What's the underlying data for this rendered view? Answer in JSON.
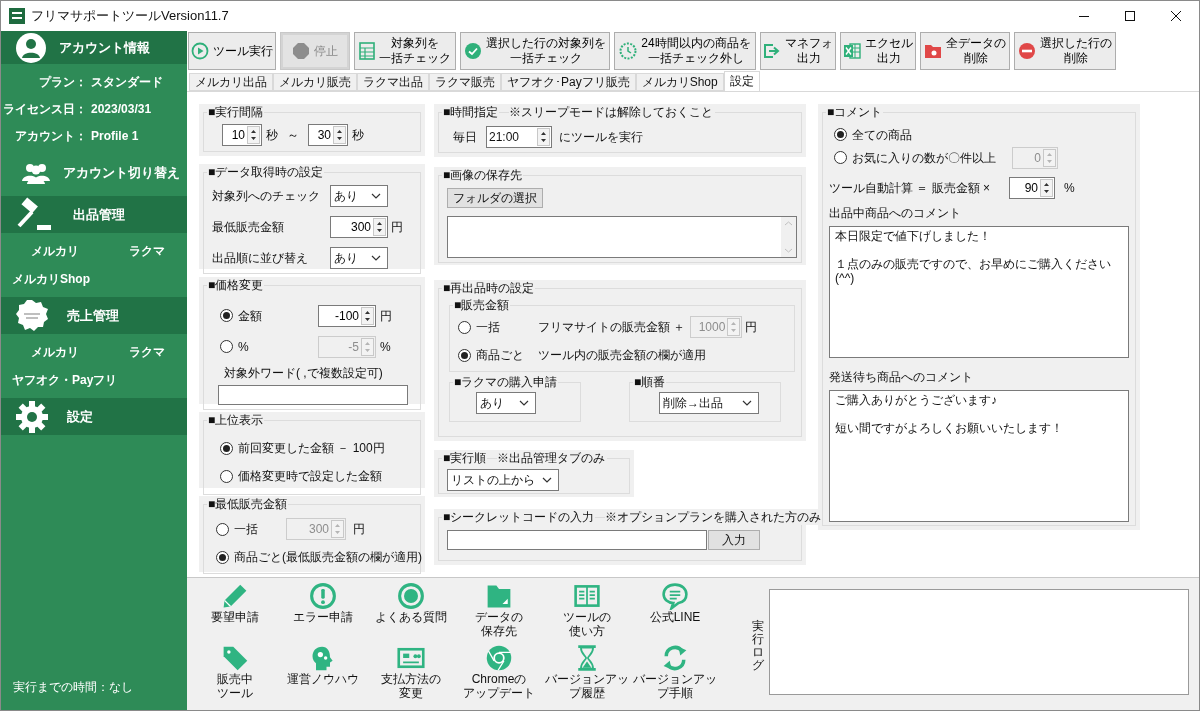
{
  "window": {
    "title": "フリマサポートツールVersion11.7"
  },
  "sidebar": {
    "account": {
      "label": "アカウント情報"
    },
    "info": [
      {
        "label": "プラン：",
        "value": "スタンダード"
      },
      {
        "label": "ライセンス日：",
        "value": "2023/03/31"
      },
      {
        "label": "アカウント：",
        "value": "Profile 1"
      }
    ],
    "switch_account": {
      "label": "アカウント切り替え"
    },
    "sections": [
      {
        "label": "出品管理",
        "rows": [
          [
            "メルカリ",
            "ラクマ"
          ],
          [
            "メルカリShop"
          ]
        ]
      },
      {
        "label": "売上管理",
        "rows": [
          [
            "メルカリ",
            "ラクマ"
          ],
          [
            "ヤフオク・Payフリ"
          ]
        ]
      },
      {
        "label": "設定"
      }
    ],
    "status": "実行までの時間：なし"
  },
  "toolbar": [
    {
      "lines": [
        "ツール実行"
      ],
      "disabled": false
    },
    {
      "lines": [
        "停止"
      ],
      "disabled": true
    },
    {
      "lines": [
        "対象列を",
        "一括チェック"
      ],
      "disabled": false
    },
    {
      "lines": [
        "選択した行の対象列を",
        "一括チェック"
      ],
      "disabled": false
    },
    {
      "lines": [
        "24時間以内の商品を",
        "一括チェック外し"
      ],
      "disabled": false
    },
    {
      "lines": [
        "マネフォ",
        "出力"
      ],
      "disabled": false
    },
    {
      "lines": [
        "エクセル",
        "出力"
      ],
      "disabled": false
    },
    {
      "lines": [
        "全データの",
        "削除"
      ],
      "disabled": false
    },
    {
      "lines": [
        "選択した行の",
        "削除"
      ],
      "disabled": false
    }
  ],
  "tabs": [
    {
      "label": "メルカリ出品",
      "selected": false
    },
    {
      "label": "メルカリ販売",
      "selected": false
    },
    {
      "label": "ラクマ出品",
      "selected": false
    },
    {
      "label": "ラクマ販売",
      "selected": false
    },
    {
      "label": "ヤフオク･Payフリ販売",
      "selected": false
    },
    {
      "label": "メルカリShop",
      "selected": false
    },
    {
      "label": "設定",
      "selected": true
    }
  ],
  "settings": {
    "interval": {
      "title": "■実行間隔",
      "from": {
        "value": "10",
        "disabled": false
      },
      "from_unit": "秒",
      "separator": "～",
      "to": {
        "value": "30",
        "disabled": false
      },
      "to_unit": "秒"
    },
    "data_fetch": {
      "title": "■データ取得時の設定",
      "rows": [
        {
          "kind": "select",
          "label": "対象列へのチェック",
          "value": "あり"
        },
        {
          "kind": "spin",
          "label": "最低販売金額",
          "value": "300",
          "disabled": false,
          "unit": "円"
        },
        {
          "kind": "select",
          "label": "出品順に並び替え",
          "value": "あり"
        }
      ]
    },
    "price_change": {
      "title": "■価格変更",
      "options": [
        {
          "label": "金額",
          "selected": true,
          "value": "-100",
          "disabled": false,
          "unit": "円"
        },
        {
          "label": "%",
          "selected": false,
          "value": "-5",
          "disabled": true,
          "unit": "%"
        }
      ],
      "exclude_label": "対象外ワード( ,で複数設定可)"
    },
    "top_display": {
      "title": "■上位表示",
      "options": [
        {
          "label": "前回変更した金額 － 100円",
          "selected": true
        },
        {
          "label": "価格変更時で設定した金額",
          "selected": false
        }
      ]
    },
    "min_price": {
      "title": "■最低販売金額",
      "options": [
        {
          "label": "一括",
          "selected": false,
          "value": "300",
          "disabled": true,
          "unit": "円"
        },
        {
          "label": "商品ごと(最低販売金額の欄が適用)",
          "selected": true
        }
      ]
    },
    "schedule": {
      "title": "■時間指定",
      "note": "※スリープモードは解除しておくこと",
      "prefix": "毎日",
      "time": "21:00",
      "suffix": "にツールを実行"
    },
    "image_folder": {
      "title": "■画像の保存先",
      "button": "フォルダの選択"
    },
    "relist": {
      "title": "■再出品時の設定",
      "price": {
        "title": "■販売金額",
        "options": [
          {
            "label": "一括",
            "description": "フリマサイトの販売金額 ＋",
            "selected": false,
            "value": "1000",
            "disabled": true,
            "unit": "円"
          },
          {
            "label": "商品ごと",
            "description": "ツール内の販売金額の欄が適用",
            "selected": true
          }
        ]
      },
      "rakuma": {
        "title": "■ラクマの購入申請",
        "value": "あり"
      },
      "order": {
        "title": "■順番",
        "value": "削除→出品"
      }
    },
    "exec_order": {
      "title": "■実行順",
      "note": "※出品管理タブのみ",
      "value": "リストの上から"
    },
    "secret": {
      "title": "■シークレットコードの入力",
      "note": "※オプションプランを購入された方のみ",
      "button": "入力"
    },
    "comment": {
      "title": "■コメント",
      "options": [
        {
          "label": "全ての商品",
          "selected": true
        },
        {
          "label": "お気に入りの数が〇件以上",
          "selected": false,
          "value": "0",
          "disabled": true
        }
      ],
      "auto_calc": {
        "label": "ツール自動計算 ＝ 販売金額 ×",
        "value": "90",
        "disabled": false,
        "unit": "%"
      },
      "listing_label": "出品中商品へのコメント",
      "listing_comment": [
        "本日限定で値下げしました！",
        "１点のみの販売ですので、お早めにご購入ください(^^)"
      ],
      "shipping_label": "発送待ち商品へのコメント",
      "shipping_comment": [
        "ご購入ありがとうございます♪",
        "短い間ですがよろしくお願いいたします！"
      ]
    }
  },
  "shortcuts": [
    {
      "lines": [
        "要望申請"
      ]
    },
    {
      "lines": [
        "エラー申請"
      ]
    },
    {
      "lines": [
        "よくある質問"
      ]
    },
    {
      "lines": [
        "データの",
        "保存先"
      ]
    },
    {
      "lines": [
        "ツールの",
        "使い方"
      ]
    },
    {
      "lines": [
        "公式LINE"
      ]
    },
    {
      "lines": [
        "販売中",
        "ツール"
      ]
    },
    {
      "lines": [
        "運営ノウハウ"
      ]
    },
    {
      "lines": [
        "支払方法の",
        "変更"
      ]
    },
    {
      "lines": [
        "Chromeの",
        "アップデート"
      ]
    },
    {
      "lines": [
        "バージョンアッ",
        "プ履歴"
      ]
    },
    {
      "lines": [
        "バージョンアッ",
        "プ手順"
      ]
    }
  ],
  "log": {
    "label": "実行ログ"
  }
}
